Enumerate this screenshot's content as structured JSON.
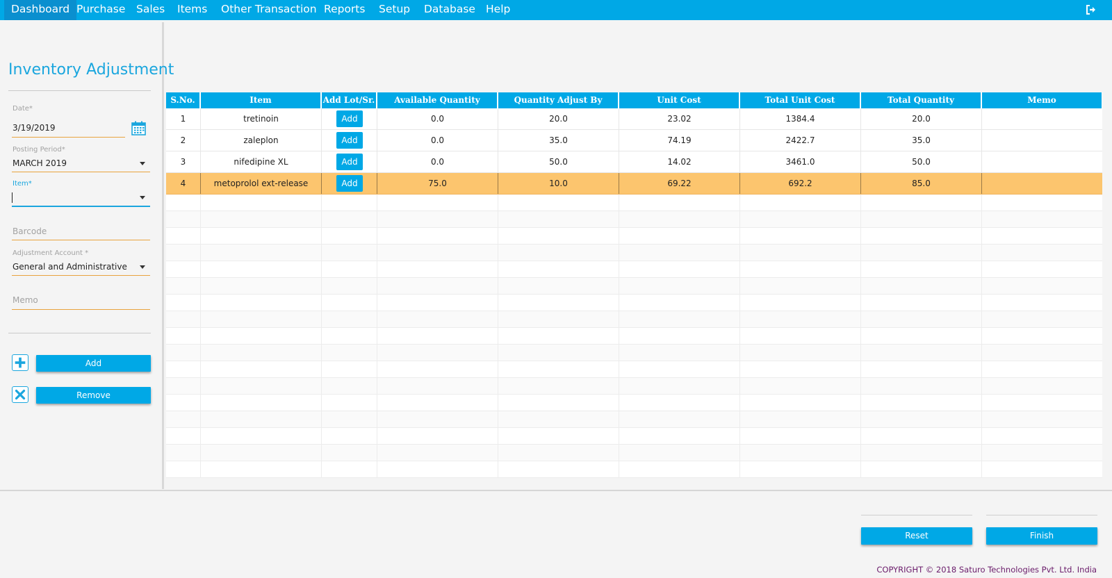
{
  "menu": {
    "items": [
      "Dashboard",
      "Purchase",
      "Sales",
      "Items",
      "Other Transaction",
      "Reports",
      "Setup",
      "Database",
      "Help"
    ],
    "active": "Dashboard",
    "logout_icon": "logout-icon"
  },
  "page": {
    "title": "Inventory Adjustment"
  },
  "form": {
    "date_label": "Date*",
    "date_value": "3/19/2019",
    "posting_period_label": "Posting Period*",
    "posting_period_value": "MARCH 2019",
    "item_label": "Item*",
    "item_value": "",
    "barcode_placeholder": "Barcode",
    "adjustment_account_label": "Adjustment Account *",
    "adjustment_account_value": "General and Administrative",
    "memo_placeholder": "Memo",
    "add_label": "Add",
    "remove_label": "Remove"
  },
  "table": {
    "columns": [
      "S.No.",
      "Item",
      "Add Lot/Sr.",
      "Available Quantity",
      "Quantity Adjust By",
      "Unit Cost",
      "Total Unit Cost",
      "Total Quantity",
      "Memo"
    ],
    "row_button_label": "Add",
    "rows": [
      {
        "sno": "1",
        "item": "tretinoin",
        "available": "0.0",
        "adjust_by": "20.0",
        "unit_cost": "23.02",
        "total_unit_cost": "1384.4",
        "total_qty": "20.0",
        "memo": ""
      },
      {
        "sno": "2",
        "item": "zaleplon",
        "available": "0.0",
        "adjust_by": "35.0",
        "unit_cost": "74.19",
        "total_unit_cost": "2422.7",
        "total_qty": "35.0",
        "memo": ""
      },
      {
        "sno": "3",
        "item": "nifedipine XL",
        "available": "0.0",
        "adjust_by": "50.0",
        "unit_cost": "14.02",
        "total_unit_cost": "3461.0",
        "total_qty": "50.0",
        "memo": ""
      },
      {
        "sno": "4",
        "item": "metoprolol ext-release",
        "available": "75.0",
        "adjust_by": "10.0",
        "unit_cost": "69.22",
        "total_unit_cost": "692.2",
        "total_qty": "85.0",
        "memo": ""
      }
    ],
    "selected_row": 4
  },
  "footer": {
    "reset_label": "Reset",
    "finish_label": "Finish",
    "copyright": "COPYRIGHT © 2018 Saturo Technologies Pvt. Ltd. India"
  },
  "colors": {
    "accent": "#00a8e6",
    "selected_row": "#fcc56e",
    "field_underline": "#e8a33e",
    "copyright": "#6a1b6a"
  }
}
